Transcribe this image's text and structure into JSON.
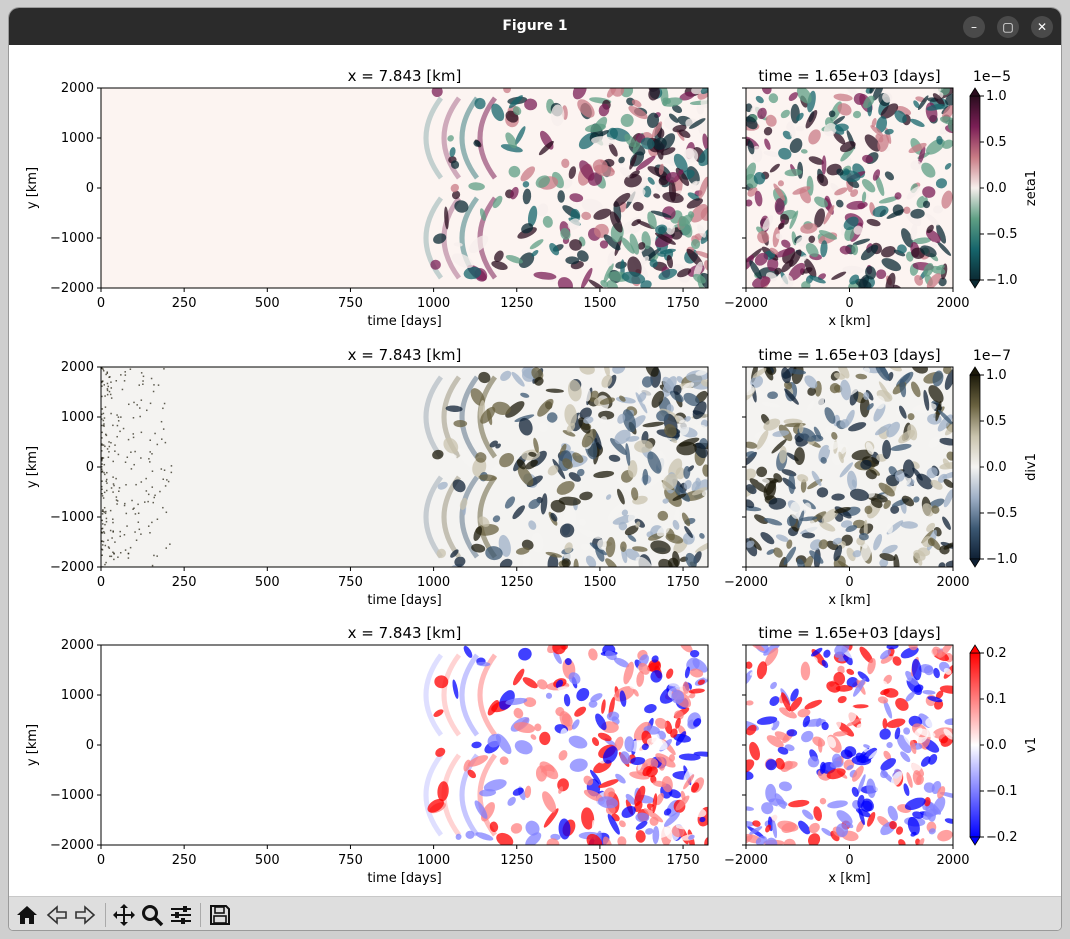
{
  "window": {
    "title": "Figure 1"
  },
  "rows": [
    {
      "left_title": "x = 7.843 [km]",
      "right_title": "time = 1.65e+03 [days]",
      "colorbar_label": "zeta1",
      "colorbar_exponent": "1e−5",
      "colorbar_ticks": [
        "1.0",
        "0.5",
        "0.0",
        "−0.5",
        "−1.0"
      ],
      "colors": [
        "#2a0c1e",
        "#7b1f56",
        "#c97b85",
        "#f7efec",
        "#5f9f84",
        "#16656b",
        "#0b2a33"
      ],
      "extend": "both"
    },
    {
      "left_title": "x = 7.843 [km]",
      "right_title": "time = 1.65e+03 [days]",
      "colorbar_label": "div1",
      "colorbar_exponent": "1e−7",
      "colorbar_ticks": [
        "1.0",
        "0.5",
        "0.0",
        "−0.5",
        "−1.0"
      ],
      "colors": [
        "#1c1a0a",
        "#6a6240",
        "#c9c3ad",
        "#f5f4f2",
        "#9fb0c7",
        "#3c5873",
        "#0f2034"
      ],
      "extend": "both"
    },
    {
      "left_title": "x = 7.843 [km]",
      "right_title": "time = 1.65e+03 [days]",
      "colorbar_label": "v1",
      "colorbar_exponent": "",
      "colorbar_ticks": [
        "0.2",
        "0.1",
        "0.0",
        "−0.1",
        "−0.2"
      ],
      "colors": [
        "#ff0000",
        "#ff8080",
        "#ffffff",
        "#8080ff",
        "#0000ff"
      ],
      "extend": "both"
    }
  ],
  "axes": {
    "left_xlabel": "time [days]",
    "left_xticks": [
      "0",
      "250",
      "500",
      "750",
      "1000",
      "1250",
      "1500",
      "1750"
    ],
    "ylabel": "y [km]",
    "yticks": [
      "2000",
      "1000",
      "0",
      "−1000",
      "−2000"
    ],
    "right_xlabel": "x [km]",
    "right_xticks": [
      "−2000",
      "0",
      "2000"
    ]
  },
  "toolbar": {
    "buttons": [
      "home-icon",
      "back-icon",
      "forward-icon",
      "pan-icon",
      "zoom-icon",
      "configure-icon",
      "save-icon"
    ]
  }
}
